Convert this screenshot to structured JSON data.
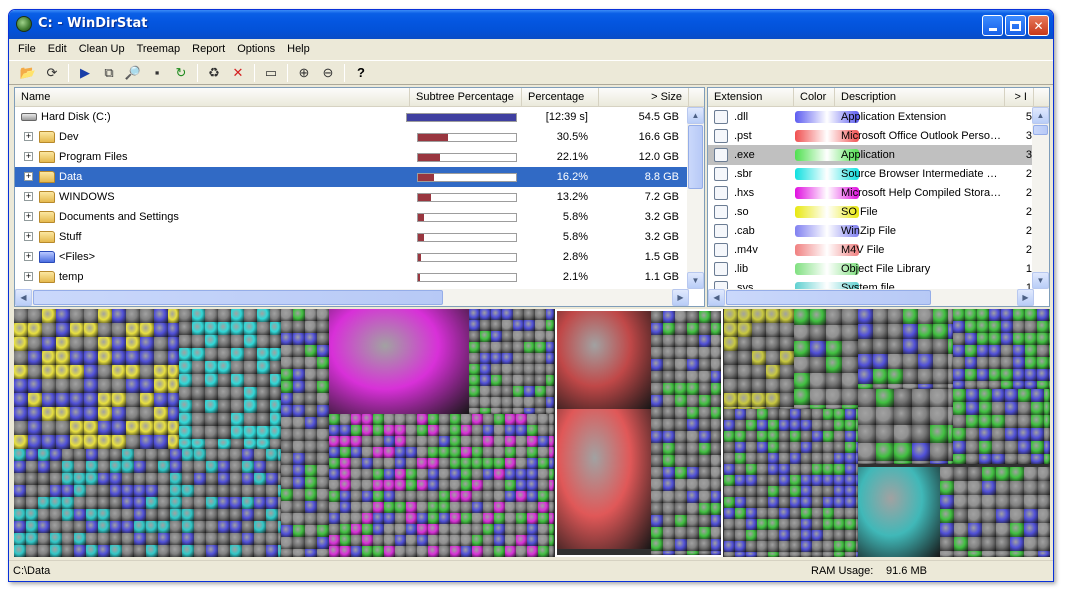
{
  "window": {
    "title": "C: - WinDirStat"
  },
  "menu": [
    "File",
    "Edit",
    "Clean Up",
    "Treemap",
    "Report",
    "Options",
    "Help"
  ],
  "toolbar": [
    {
      "name": "open-icon",
      "glyph": "📂"
    },
    {
      "name": "refresh-icon",
      "glyph": "⟳"
    },
    {
      "sep": true
    },
    {
      "name": "play-icon",
      "glyph": "▶"
    },
    {
      "name": "copy-icon",
      "glyph": "⧉"
    },
    {
      "name": "explorer-icon",
      "glyph": "🔎"
    },
    {
      "name": "command-prompt-icon",
      "glyph": "▪"
    },
    {
      "name": "rescan-icon",
      "glyph": "↻"
    },
    {
      "sep": true
    },
    {
      "name": "recycle-icon",
      "glyph": "♻"
    },
    {
      "name": "delete-icon",
      "glyph": "✕"
    },
    {
      "sep": true
    },
    {
      "name": "properties-icon",
      "glyph": "▭"
    },
    {
      "sep": true
    },
    {
      "name": "zoom-in-icon",
      "glyph": "⊕"
    },
    {
      "name": "zoom-out-icon",
      "glyph": "⊖"
    },
    {
      "sep": true
    },
    {
      "name": "help-icon",
      "glyph": "?"
    }
  ],
  "dir_list": {
    "headers": {
      "name": "Name",
      "subtree": "Subtree Percentage",
      "percentage": "Percentage",
      "size": "> Size"
    },
    "rows": [
      {
        "name": "Hard Disk (C:)",
        "kind": "drive",
        "bar": 1.0,
        "percentage": "[12:39 s]",
        "size": "54.5 GB"
      },
      {
        "name": "Dev",
        "kind": "folder",
        "bar": 0.305,
        "percentage": "30.5%",
        "size": "16.6 GB"
      },
      {
        "name": "Program Files",
        "kind": "folder",
        "bar": 0.221,
        "percentage": "22.1%",
        "size": "12.0 GB"
      },
      {
        "name": "Data",
        "kind": "folder",
        "bar": 0.162,
        "percentage": "16.2%",
        "size": "8.8 GB",
        "selected": true
      },
      {
        "name": "WINDOWS",
        "kind": "folder",
        "bar": 0.132,
        "percentage": "13.2%",
        "size": "7.2 GB"
      },
      {
        "name": "Documents and Settings",
        "kind": "folder",
        "bar": 0.058,
        "percentage": "5.8%",
        "size": "3.2 GB"
      },
      {
        "name": "Stuff",
        "kind": "folder",
        "bar": 0.058,
        "percentage": "5.8%",
        "size": "3.2 GB"
      },
      {
        "name": "<Files>",
        "kind": "files",
        "bar": 0.028,
        "percentage": "2.8%",
        "size": "1.5 GB"
      },
      {
        "name": "temp",
        "kind": "folder",
        "bar": 0.021,
        "percentage": "2.1%",
        "size": "1.1 GB"
      }
    ]
  },
  "ext_list": {
    "headers": {
      "extension": "Extension",
      "color": "Color",
      "description": "Description",
      "bytes": "> I"
    },
    "rows": [
      {
        "ext": ".dll",
        "color": "#5c5cf0",
        "description": "Application Extension",
        "bytes": "5"
      },
      {
        "ext": ".pst",
        "color": "#f05050",
        "description": "Microsoft Office Outlook Perso…",
        "bytes": "3"
      },
      {
        "ext": ".exe",
        "color": "#50e050",
        "description": "Application",
        "bytes": "3",
        "selected": true
      },
      {
        "ext": ".sbr",
        "color": "#10e0e0",
        "description": "Source Browser Intermediate …",
        "bytes": "2"
      },
      {
        "ext": ".hxs",
        "color": "#e010e0",
        "description": "Microsoft Help Compiled Stora…",
        "bytes": "2"
      },
      {
        "ext": ".so",
        "color": "#e8e810",
        "description": "SO File",
        "bytes": "2"
      },
      {
        "ext": ".cab",
        "color": "#8080f0",
        "description": "WinZip File",
        "bytes": "2"
      },
      {
        "ext": ".m4v",
        "color": "#f08080",
        "description": "M4V File",
        "bytes": "2"
      },
      {
        "ext": ".lib",
        "color": "#80e080",
        "description": "Object File Library",
        "bytes": "1"
      },
      {
        "ext": ".sys",
        "color": "#60d0d0",
        "description": "System file",
        "bytes": "1"
      }
    ]
  },
  "status": {
    "path": "C:\\Data",
    "ram_label": "RAM Usage:",
    "ram_value": "91.6 MB"
  }
}
